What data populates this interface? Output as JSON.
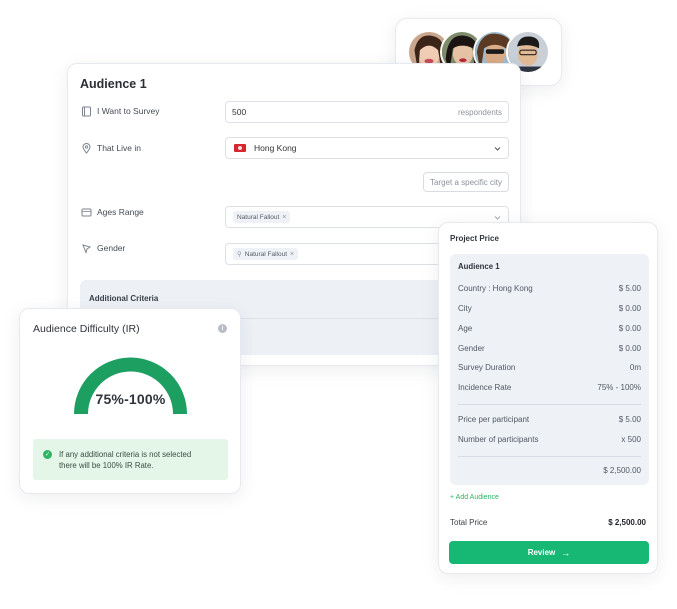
{
  "audience": {
    "title": "Audience 1",
    "rows": {
      "survey": {
        "label": "I Want to Survey",
        "value": "500",
        "suffix": "respondents"
      },
      "live": {
        "label": "That Live in",
        "value": "Hong Kong"
      },
      "ages": {
        "label": "Ages Range",
        "chip": "Natural Fallout"
      },
      "gender": {
        "label": "Gender",
        "chip": "Natural Fallout"
      }
    },
    "target_city_button": "Target a specific city",
    "additional_criteria_label": "Additional Criteria"
  },
  "difficulty": {
    "title": "Audience Difficulty (IR)",
    "gauge_value": "75%-100%",
    "note_line1": "If any additional criteria is not selected",
    "note_line2": "there will be 100% IR Rate."
  },
  "price": {
    "title": "Project Price",
    "box_title": "Audience 1",
    "rows": [
      {
        "label": "Country : Hong Kong",
        "value": "$ 5.00"
      },
      {
        "label": "City",
        "value": "$ 0.00"
      },
      {
        "label": "Age",
        "value": "$ 0.00"
      },
      {
        "label": "Gender",
        "value": "$ 0.00"
      },
      {
        "label": "Survey Duration",
        "value": "0m"
      },
      {
        "label": "Incidence Rate",
        "value": "75% - 100%"
      }
    ],
    "per_participant": {
      "label": "Price per participant",
      "value": "$ 5.00"
    },
    "num_participants": {
      "label": "Number of participants",
      "value": "x 500"
    },
    "subtotal": "$ 2,500.00",
    "add_audience": "+ Add Audience",
    "total_label": "Total Price",
    "total_value": "$ 2,500.00",
    "review_label": "Review",
    "review_arrow": "→"
  },
  "colors": {
    "accent_green": "#16b873",
    "gauge_green": "#1e9f62",
    "note_bg": "#e3f6e8"
  }
}
